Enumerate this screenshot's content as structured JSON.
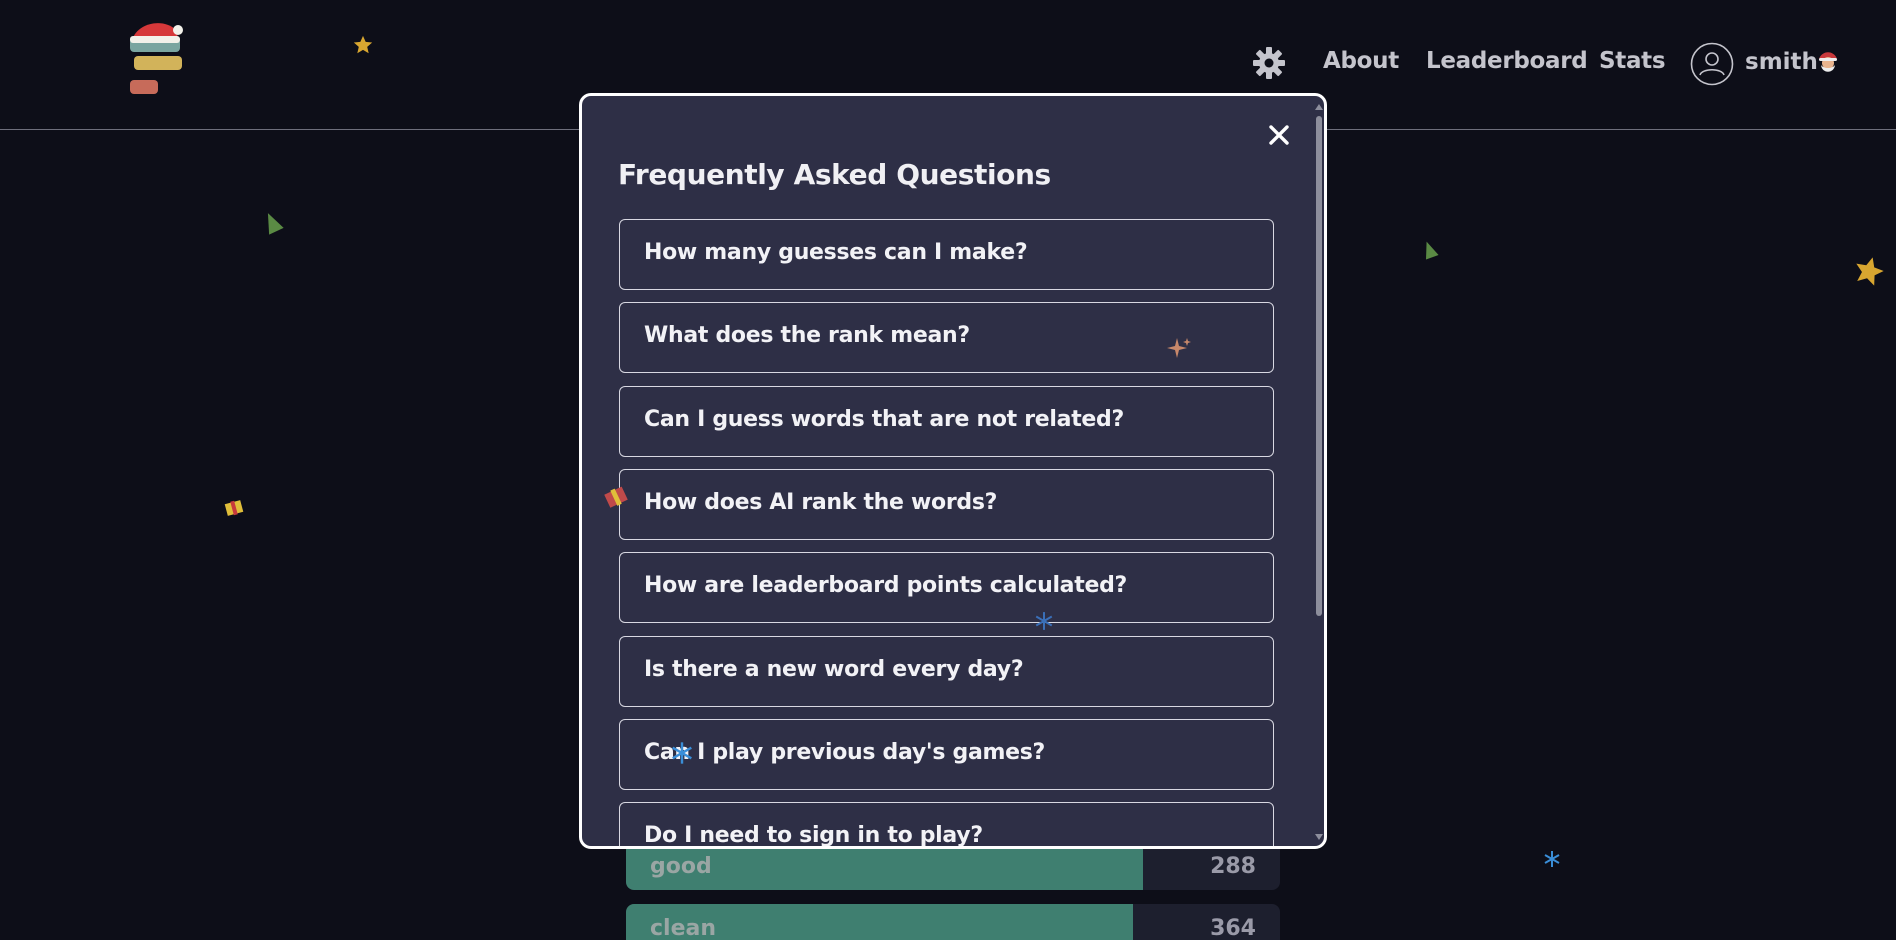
{
  "header": {
    "nav": {
      "about": "About",
      "leaderboard": "Leaderboard",
      "stats": "Stats"
    },
    "user": {
      "name": "smith"
    }
  },
  "modal": {
    "title": "Frequently Asked Questions",
    "close_icon": "close-icon",
    "questions": [
      "How many guesses can I make?",
      "What does the rank mean?",
      "Can I guess words that are not related?",
      "How does AI rank the words?",
      "How are leaderboard points calculated?",
      "Is there a new word every day?",
      "Can I play previous day's games?",
      "Do I need to sign in to play?"
    ]
  },
  "background_list": [
    {
      "word": "good",
      "rank": "288",
      "fill": 0.79
    },
    {
      "word": "clean",
      "rank": "364",
      "fill": 0.775
    }
  ],
  "colors": {
    "background": "#0d0e18",
    "modal": "#2e2f46",
    "accent_bar": "#3f7f70"
  }
}
